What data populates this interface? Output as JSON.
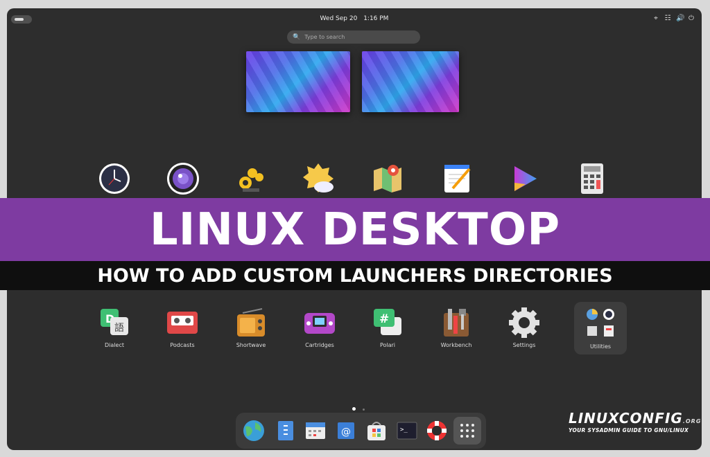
{
  "topbar": {
    "date": "Wed Sep 20",
    "time": "1:16 PM",
    "tray_icons": [
      "location-icon",
      "network-icon",
      "volume-icon",
      "power-icon"
    ]
  },
  "search": {
    "placeholder": "Type to search"
  },
  "banner": {
    "title": "LINUX DESKTOP",
    "subtitle": "HOW TO ADD CUSTOM LAUNCHERS DIRECTORIES",
    "color": "#7e3ba1"
  },
  "apps_row1": [
    "clocks-icon",
    "camera-icon",
    "extensions-icon",
    "weather-icon",
    "maps-icon",
    "text-editor-icon",
    "videos-icon",
    "calculator-icon"
  ],
  "apps_row2": [
    {
      "label": "Dialect",
      "icon": "dialect-icon"
    },
    {
      "label": "Podcasts",
      "icon": "podcasts-icon"
    },
    {
      "label": "Shortwave",
      "icon": "shortwave-icon"
    },
    {
      "label": "Cartridges",
      "icon": "cartridges-icon"
    },
    {
      "label": "Polari",
      "icon": "polari-icon"
    },
    {
      "label": "Workbench",
      "icon": "workbench-icon"
    },
    {
      "label": "Settings",
      "icon": "settings-icon"
    },
    {
      "label": "Utilities",
      "icon": "utilities-folder-icon"
    }
  ],
  "dock": [
    "browser-icon",
    "files-icon",
    "calendar-icon",
    "mail-icon",
    "software-icon",
    "terminal-icon",
    "help-icon",
    "show-apps-icon"
  ],
  "brand": {
    "name": "LINUXCONFIG",
    "suffix": ".ORG",
    "tagline": "YOUR SYSADMIN GUIDE TO GNU/LINUX"
  }
}
